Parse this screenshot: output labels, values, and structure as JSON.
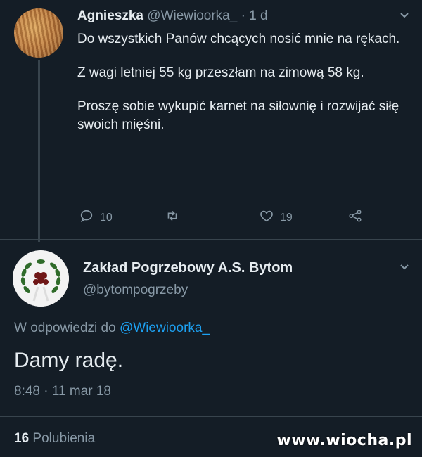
{
  "tweet": {
    "author_name": "Agnieszka",
    "author_handle": "@Wiewioorka_",
    "time_ago": "· 1 d",
    "paragraphs": [
      "Do wszystkich Panów chcących nosić mnie na rękach.",
      "Z wagi letniej 55 kg przeszłam na zimową 58 kg.",
      "Proszę sobie wykupić karnet na siłownię i rozwijać siłę swoich mięśni."
    ],
    "reply_count": "10",
    "like_count": "19",
    "icons": [
      "chevron-down-icon",
      "reply-icon",
      "retweet-icon",
      "heart-icon",
      "share-icon"
    ]
  },
  "reply_tweet": {
    "author_name": "Zakład Pogrzebowy A.S. Bytom",
    "author_handle": "@bytompogrzeby",
    "in_reply_prefix": "W odpowiedzi do",
    "in_reply_handle": "@Wiewioorka_",
    "text": "Damy radę.",
    "timestamp": "8:48 · 11 mar 18",
    "likes_count": "16",
    "likes_label": "Polubienia"
  },
  "watermark": "www.wiocha.pl",
  "colors": {
    "background": "#141d26",
    "text": "#e6ecf0",
    "muted": "#8899a6",
    "link": "#1da1f2",
    "divider": "#38444d"
  }
}
